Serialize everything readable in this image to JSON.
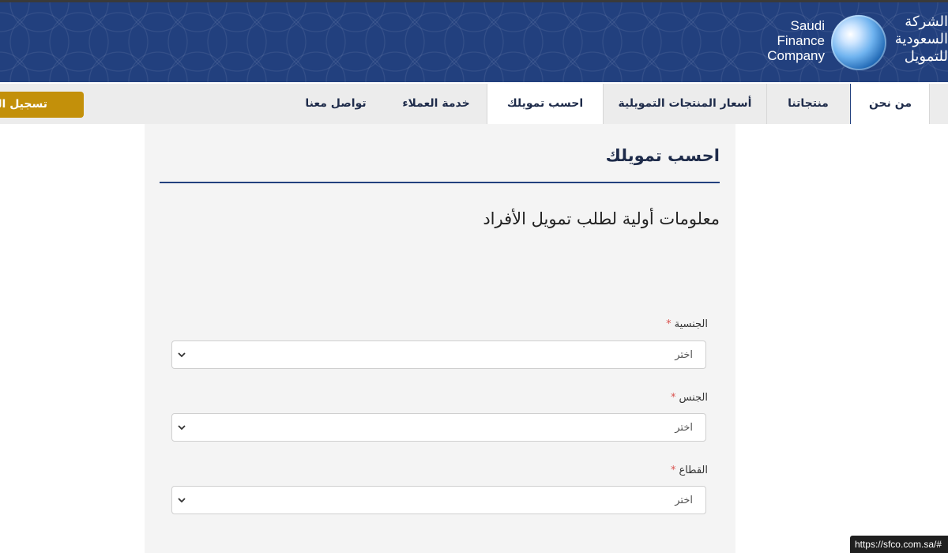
{
  "header": {
    "logo": {
      "en_lines": [
        "Saudi",
        "Finance",
        "Company"
      ],
      "ar_lines": [
        "الشركة",
        "السعودية",
        "للتمويل"
      ]
    }
  },
  "nav": {
    "items": [
      {
        "label": "من نحن"
      },
      {
        "label": "منتجاتنا"
      },
      {
        "label": "أسعار المنتجات التمويلية"
      },
      {
        "label": "احسب تمويلك"
      },
      {
        "label": "خدمة العملاء"
      },
      {
        "label": "تواصل معنا"
      }
    ],
    "active_index": 3,
    "register_label": "تسجيل الدخول"
  },
  "main": {
    "title": "احسب تمويلك",
    "subtitle": "معلومات أولية لطلب تمويل الأفراد",
    "fields": [
      {
        "label": "الجنسية",
        "required_mark": "*",
        "value": "اختر"
      },
      {
        "label": "الجنس",
        "required_mark": "*",
        "value": "اختر"
      },
      {
        "label": "القطاع",
        "required_mark": "*",
        "value": "اختر"
      }
    ]
  },
  "status_bar": {
    "url": "https://sfco.com.sa/#"
  },
  "colors": {
    "header_bg": "#22407e",
    "register_btn": "#c3900a",
    "required": "#d9534f"
  }
}
